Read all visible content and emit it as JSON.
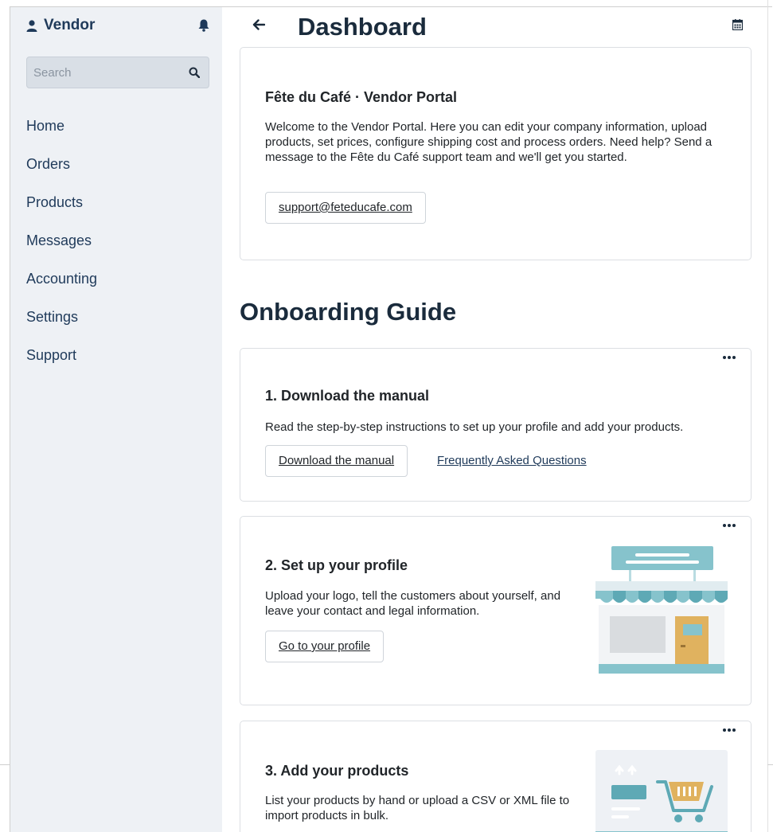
{
  "sidebar": {
    "brand": "Vendor",
    "search_placeholder": "Search",
    "nav": [
      "Home",
      "Orders",
      "Products",
      "Messages",
      "Accounting",
      "Settings",
      "Support"
    ]
  },
  "header": {
    "title": "Dashboard"
  },
  "welcome": {
    "title": "Fête du Café · Vendor Portal",
    "text": "Welcome to the Vendor Portal. Here you can edit your company information, upload products, set prices, configure shipping cost and process orders. Need help? Send a message to the Fête du Café support team and we'll get you started.",
    "email_button": "support@feteducafe.com"
  },
  "onboarding": {
    "title": "Onboarding Guide",
    "steps": [
      {
        "title": "1. Download the manual",
        "text": "Read the step-by-step instructions to set up your profile and add your products.",
        "primary": "Download the manual",
        "secondary": "Frequently Asked Questions"
      },
      {
        "title": "2. Set up your profile",
        "text": "Upload your logo, tell the customers about yourself, and leave your contact and legal information.",
        "primary": "Go to your profile"
      },
      {
        "title": "3. Add your products",
        "text": "List your products by hand or upload a CSV or XML file to import products in bulk."
      }
    ]
  },
  "icons": {
    "user": "user-icon",
    "bell": "bell-icon",
    "search": "search-icon",
    "back": "arrow-left-icon",
    "calendar": "calendar-icon",
    "more": "more-horizontal-icon"
  },
  "colors": {
    "sidebar_bg": "#eef1f5",
    "accent": "#1f3a5a",
    "teal": "#86c3cc",
    "door": "#e0b25f"
  }
}
